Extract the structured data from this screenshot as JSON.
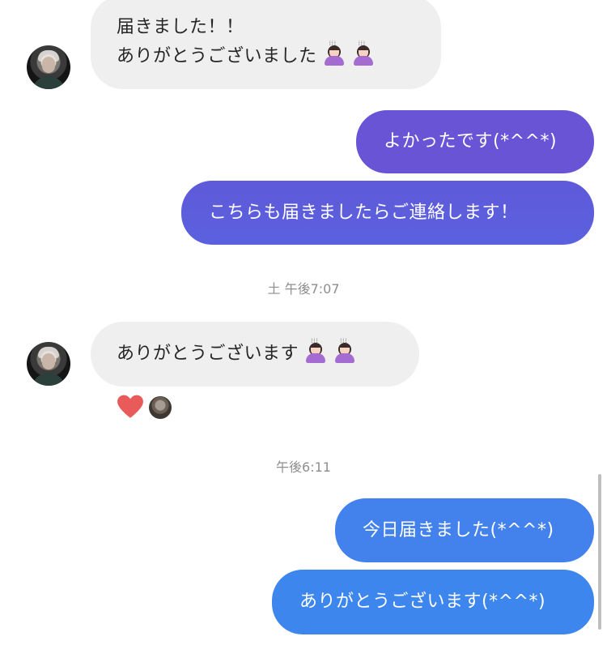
{
  "colors": {
    "incoming_bubble": "#efefef",
    "outgoing_gradient_top": "#6a54d6",
    "outgoing_gradient_mid": "#5c6ae0",
    "outgoing_gradient_bottom": "#3e84ee",
    "timestamp_text": "#8e8e8e",
    "reaction_heart": "#e95b5b"
  },
  "messages": [
    {
      "direction": "incoming",
      "lines": [
        "届きました！！",
        "ありがとうございました"
      ],
      "emoji": [
        "woman-bowing",
        "woman-bowing"
      ]
    },
    {
      "direction": "outgoing",
      "text": "よかったです(*^^*)"
    },
    {
      "direction": "outgoing",
      "text": "こちらも届きましたらご連絡します！"
    },
    {
      "direction": "timestamp",
      "text": "土 午後7:07"
    },
    {
      "direction": "incoming",
      "text": "ありがとうございます",
      "emoji": [
        "woman-bowing",
        "woman-bowing"
      ],
      "reactions": [
        "heart-icon",
        "user-avatar"
      ]
    },
    {
      "direction": "timestamp",
      "text": "午後6:11"
    },
    {
      "direction": "outgoing",
      "text": "今日届きました(*^^*)"
    },
    {
      "direction": "outgoing",
      "text": "ありがとうございます(*^^*)"
    }
  ]
}
